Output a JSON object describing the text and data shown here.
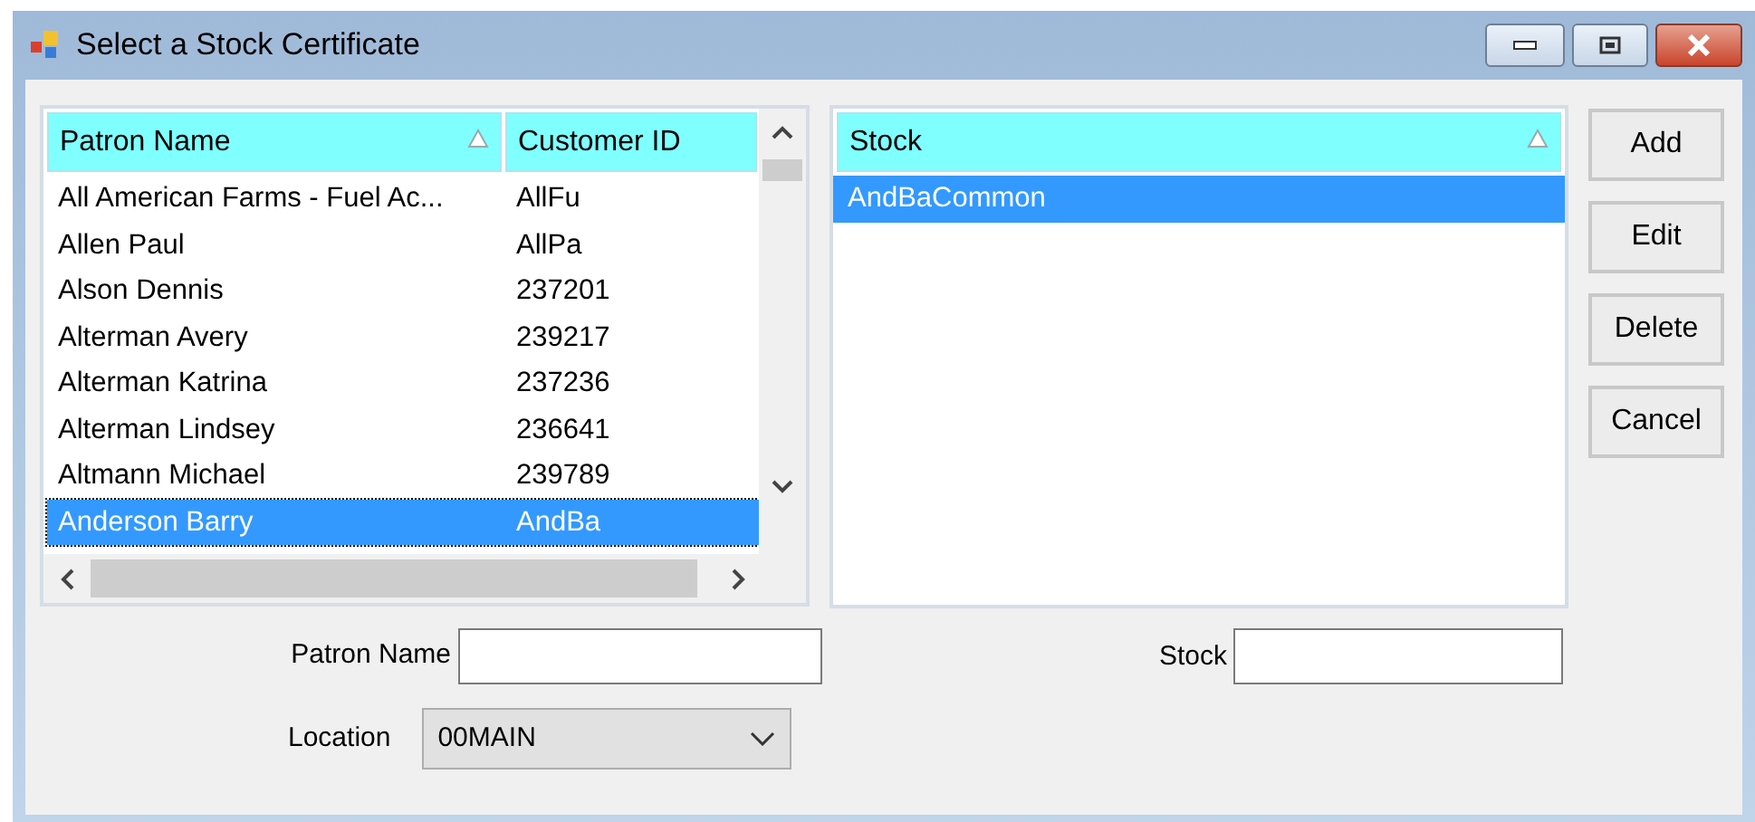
{
  "window": {
    "title": "Select a Stock Certificate"
  },
  "patron_grid": {
    "columns": [
      {
        "label": "Patron Name",
        "sorted": true
      },
      {
        "label": "Customer ID",
        "sorted": false
      }
    ],
    "rows": [
      {
        "patron_name": "All American Farms - Fuel Ac...",
        "customer_id": "AllFu",
        "selected": false
      },
      {
        "patron_name": "Allen Paul",
        "customer_id": "AllPa",
        "selected": false
      },
      {
        "patron_name": "Alson Dennis",
        "customer_id": "237201",
        "selected": false
      },
      {
        "patron_name": "Alterman Avery",
        "customer_id": "239217",
        "selected": false
      },
      {
        "patron_name": "Alterman Katrina",
        "customer_id": "237236",
        "selected": false
      },
      {
        "patron_name": "Alterman Lindsey",
        "customer_id": "236641",
        "selected": false
      },
      {
        "patron_name": "Altmann Michael",
        "customer_id": "239789",
        "selected": false
      },
      {
        "patron_name": "Anderson Barry",
        "customer_id": "AndBa",
        "selected": true
      }
    ]
  },
  "stock_grid": {
    "columns": [
      {
        "label": "Stock",
        "sorted": true
      }
    ],
    "rows": [
      {
        "stock": "AndBaCommon",
        "selected": true
      }
    ]
  },
  "buttons": [
    "Add",
    "Edit",
    "Delete",
    "Cancel"
  ],
  "filters": {
    "patron_name": {
      "label": "Patron Name"
    },
    "location": {
      "label": "Location",
      "value": "00MAIN"
    },
    "stock": {
      "label": "Stock"
    }
  }
}
